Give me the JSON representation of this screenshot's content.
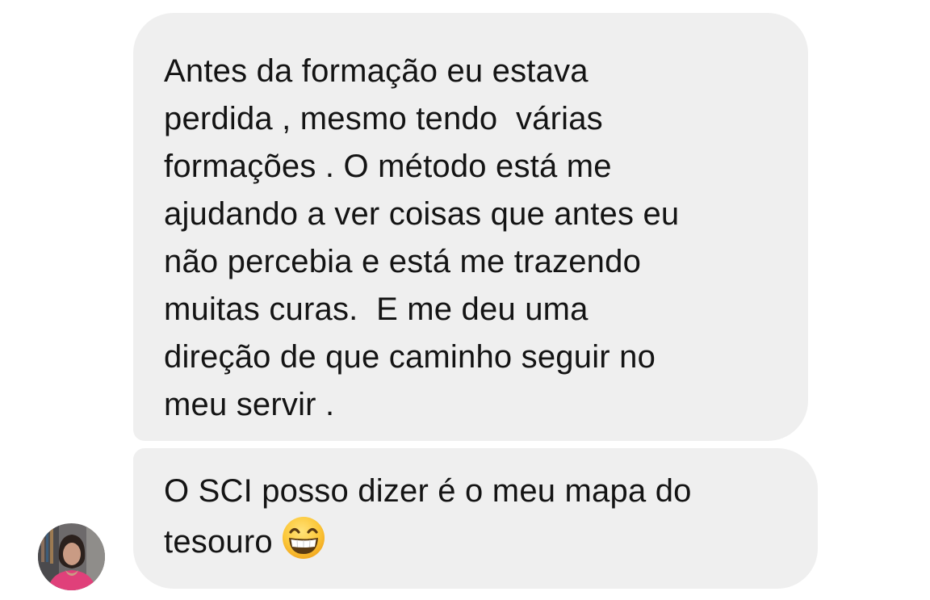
{
  "messages": [
    {
      "lines": [
        "Antes da formação eu estava",
        "perdida , mesmo tendo  várias",
        "formações . O método está me",
        "ajudando a ver coisas que antes eu",
        "não percebia e está me trazendo",
        "muitas curas.  E me deu uma",
        "direção de que caminho seguir no",
        "meu servir ."
      ]
    },
    {
      "lines": [
        "O SCI posso dizer é o meu mapa do",
        "tesouro"
      ],
      "emoji": "grinning-face-with-smiling-eyes"
    }
  ],
  "sender": {
    "avatar": "profile-photo"
  },
  "colors": {
    "bubble_bg": "#efefef",
    "text": "#141414",
    "background": "#ffffff"
  }
}
